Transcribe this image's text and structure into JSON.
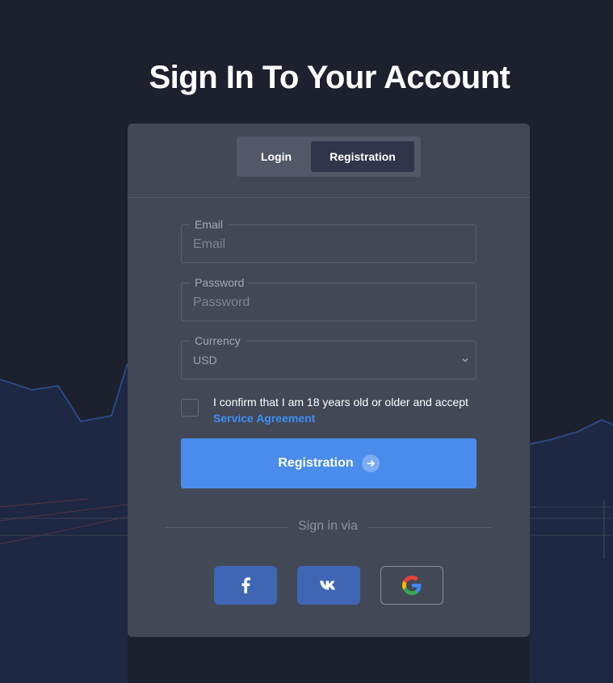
{
  "page": {
    "title": "Sign In To Your Account"
  },
  "tabs": {
    "login_label": "Login",
    "registration_label": "Registration",
    "active": "Registration"
  },
  "form": {
    "email": {
      "legend": "Email",
      "placeholder": "Email",
      "value": ""
    },
    "password": {
      "legend": "Password",
      "placeholder": "Password",
      "value": ""
    },
    "currency": {
      "legend": "Currency",
      "selected": "USD"
    },
    "consent": {
      "text": "I confirm that I am 18 years old or older and accept",
      "link_label": "Service Agreement",
      "checked": false
    },
    "submit_label": "Registration"
  },
  "social": {
    "divider_label": "Sign in via",
    "providers": [
      {
        "name": "facebook",
        "icon": "facebook-icon",
        "color": "#3f66b5"
      },
      {
        "name": "vk",
        "icon": "vk-icon",
        "color": "#3f66b5"
      },
      {
        "name": "google",
        "icon": "google-icon",
        "color": "transparent"
      }
    ]
  },
  "colors": {
    "background": "#1d202d",
    "card": "#434857",
    "accent": "#4a8cec",
    "link": "#3d8ef6",
    "social": "#3f66b5"
  }
}
